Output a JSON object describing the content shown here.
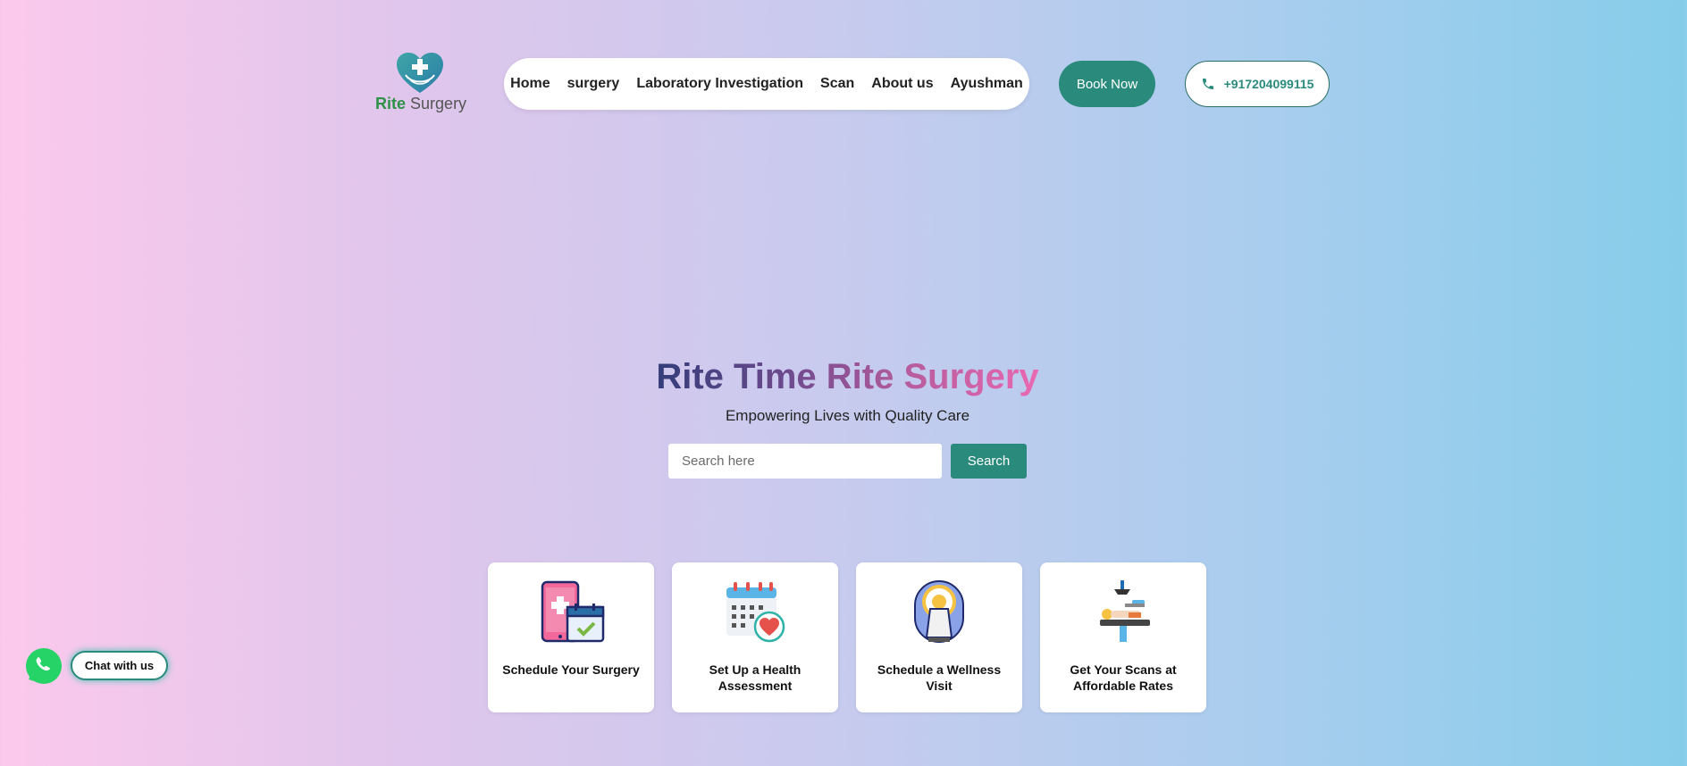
{
  "brand": {
    "name_part1": "Rite",
    "name_part2": "Surgery"
  },
  "nav": {
    "items": [
      {
        "label": "Home"
      },
      {
        "label": "surgery"
      },
      {
        "label": "Laboratory Investigation"
      },
      {
        "label": "Scan"
      },
      {
        "label": "About us"
      },
      {
        "label": "Ayushman"
      }
    ]
  },
  "header": {
    "book_label": "Book Now",
    "phone": "+917204099115"
  },
  "hero": {
    "title": "Rite Time Rite Surgery",
    "subtitle": "Empowering Lives with Quality Care",
    "search_placeholder": "Search here",
    "search_button": "Search"
  },
  "cards": [
    {
      "label": "Schedule Your Surgery",
      "icon": "phone-calendar-icon"
    },
    {
      "label": "Set Up a Health Assessment",
      "icon": "calendar-heart-icon"
    },
    {
      "label": "Schedule a Wellness Visit",
      "icon": "mri-scanner-icon"
    },
    {
      "label": "Get Your Scans at Affordable Rates",
      "icon": "operating-table-icon"
    }
  ],
  "chat": {
    "label": "Chat with us"
  },
  "colors": {
    "accent": "#2a8b7d",
    "brand_green": "#2e9148",
    "whatsapp": "#25d366"
  }
}
